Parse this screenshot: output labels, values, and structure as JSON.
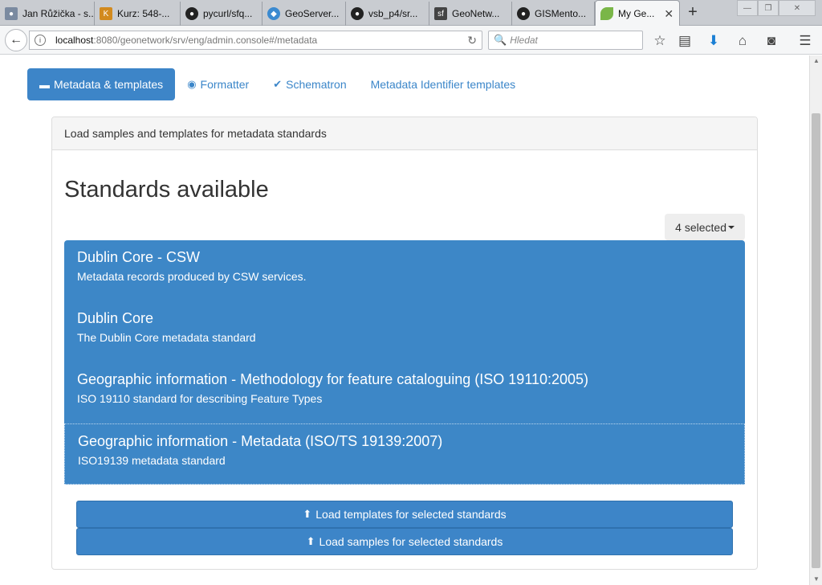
{
  "browser": {
    "tabs": [
      {
        "title": "Jan Růžička - s...",
        "fav": "person",
        "favColor": "#7a8aa0"
      },
      {
        "title": "Kurz: 548-...",
        "fav": "K",
        "favColor": "#d28a1e"
      },
      {
        "title": "pycurl/sfq...",
        "fav": "gh",
        "favColor": "#222222"
      },
      {
        "title": "GeoServer...",
        "fav": "gs",
        "favColor": "#3b8ad0"
      },
      {
        "title": "vsb_p4/sr...",
        "fav": "gh",
        "favColor": "#222222"
      },
      {
        "title": "GeoNetw...",
        "fav": "sf",
        "favColor": "#444444"
      },
      {
        "title": "GISMento...",
        "fav": "gh",
        "favColor": "#222222"
      },
      {
        "title": "My Ge...",
        "fav": "leaf",
        "favColor": "#7ab648"
      }
    ],
    "url_host": "localhost",
    "url_path": ":8080/geonetwork/srv/eng/admin.console#/metadata",
    "search_placeholder": "Hledat"
  },
  "nav": {
    "pills": [
      {
        "label": "Metadata & templates",
        "icon": "▬"
      },
      {
        "label": "Formatter",
        "icon": "👁"
      },
      {
        "label": "Schematron",
        "icon": "✔"
      },
      {
        "label": "Metadata Identifier templates",
        "icon": ""
      }
    ]
  },
  "panel": {
    "header": "Load samples and templates for metadata standards",
    "title": "Standards available",
    "dropdown": "4 selected",
    "standards": [
      {
        "title": "Dublin Core - CSW",
        "desc": "Metadata records produced by CSW services."
      },
      {
        "title": "Dublin Core",
        "desc": "The Dublin Core metadata standard"
      },
      {
        "title": "Geographic information - Methodology for feature cataloguing (ISO 19110:2005)",
        "desc": "ISO 19110 standard for describing Feature Types"
      },
      {
        "title": "Geographic information - Metadata (ISO/TS 19139:2007)",
        "desc": "ISO19139 metadata standard"
      }
    ],
    "btn_templates": "Load templates for selected standards",
    "btn_samples": "Load samples for selected standards"
  }
}
